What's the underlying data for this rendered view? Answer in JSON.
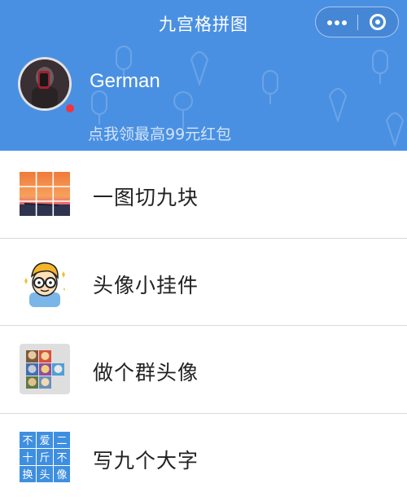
{
  "header": {
    "title": "九宫格拼图",
    "background_color": "#4a90e2",
    "capsule": {
      "more_icon": "more-dots-icon",
      "close_icon": "target-close-icon"
    }
  },
  "profile": {
    "username": "German",
    "promo": "点我领最高99元红包"
  },
  "menu": {
    "items": [
      {
        "label": "一图切九块",
        "icon": "nine-grid-sunset-icon"
      },
      {
        "label": "头像小挂件",
        "icon": "cartoon-boy-glasses-icon",
        "has_badge": true
      },
      {
        "label": "做个群头像",
        "icon": "group-avatar-collage-icon"
      },
      {
        "label": "写九个大字",
        "icon": "nine-characters-grid-icon"
      }
    ],
    "nine_chars": [
      "不",
      "爱",
      "二",
      "十",
      "斤",
      "不",
      "换",
      "头",
      "像"
    ],
    "badge_color": "#f0343f"
  }
}
